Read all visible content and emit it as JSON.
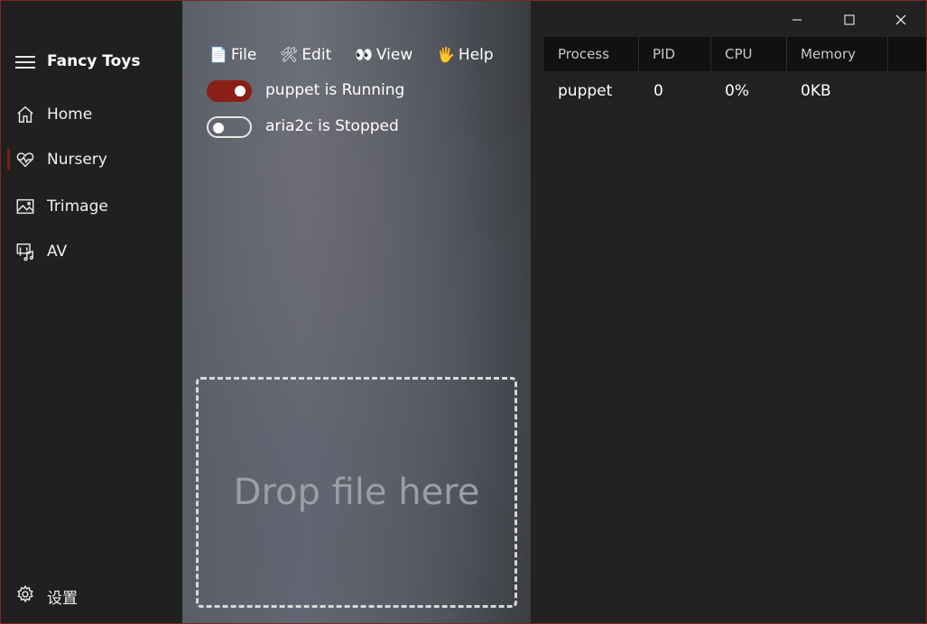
{
  "app": {
    "title": "Fancy Toys"
  },
  "sidebar": {
    "items": [
      {
        "label": "Home",
        "icon": "home-icon"
      },
      {
        "label": "Nursery",
        "icon": "heart-pulse-icon",
        "selected": true
      },
      {
        "label": "Trimage",
        "icon": "image-icon"
      },
      {
        "label": "AV",
        "icon": "media-icon"
      }
    ],
    "settings_label": "设置"
  },
  "menu": {
    "file": {
      "emoji": "📄",
      "label": "File"
    },
    "edit": {
      "emoji": "🛠",
      "label": "Edit"
    },
    "view": {
      "emoji": "👀",
      "label": "View"
    },
    "help": {
      "emoji": "🖐",
      "label": "Help"
    }
  },
  "services": [
    {
      "label": "puppet is Running",
      "on": true
    },
    {
      "label": "aria2c is Stopped",
      "on": false
    }
  ],
  "dropzone": {
    "label": "Drop file here"
  },
  "process_table": {
    "columns": [
      "Process",
      "PID",
      "CPU",
      "Memory"
    ],
    "rows": [
      {
        "process": "puppet",
        "pid": "0",
        "cpu": "0%",
        "memory": "0KB"
      }
    ]
  },
  "colors": {
    "accent": "#8a1f17",
    "border": "#7a2a22"
  }
}
